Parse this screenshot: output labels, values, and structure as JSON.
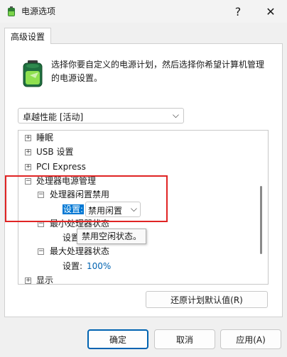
{
  "window": {
    "title": "电源选项",
    "help": "?",
    "close": "✕"
  },
  "tab": {
    "label": "高级设置"
  },
  "intro": {
    "text": "选择你要自定义的电源计划，然后选择你希望计算机管理的电源设置。"
  },
  "plan": {
    "selected": "卓越性能 [活动]"
  },
  "tree": {
    "sleep": "睡眠",
    "usb": "USB 设置",
    "pci": "PCI Express",
    "cpu_mgmt": "处理器电源管理",
    "idle_disable": "处理器闲置禁用",
    "setting_label": "设置:",
    "idle_value": "禁用闲置",
    "min_state": "最小处理器状态",
    "min_setting_label": "设置",
    "max_state": "最大处理器状态",
    "max_setting_label": "设置:",
    "max_value": "100%",
    "display": "显示"
  },
  "tooltip": {
    "text": "禁用空闲状态。"
  },
  "buttons": {
    "restore": "还原计划默认值(R)",
    "ok": "确定",
    "cancel": "取消",
    "apply": "应用(A)"
  },
  "colors": {
    "accent": "#0078d4",
    "highlight_box": "#e02424"
  }
}
